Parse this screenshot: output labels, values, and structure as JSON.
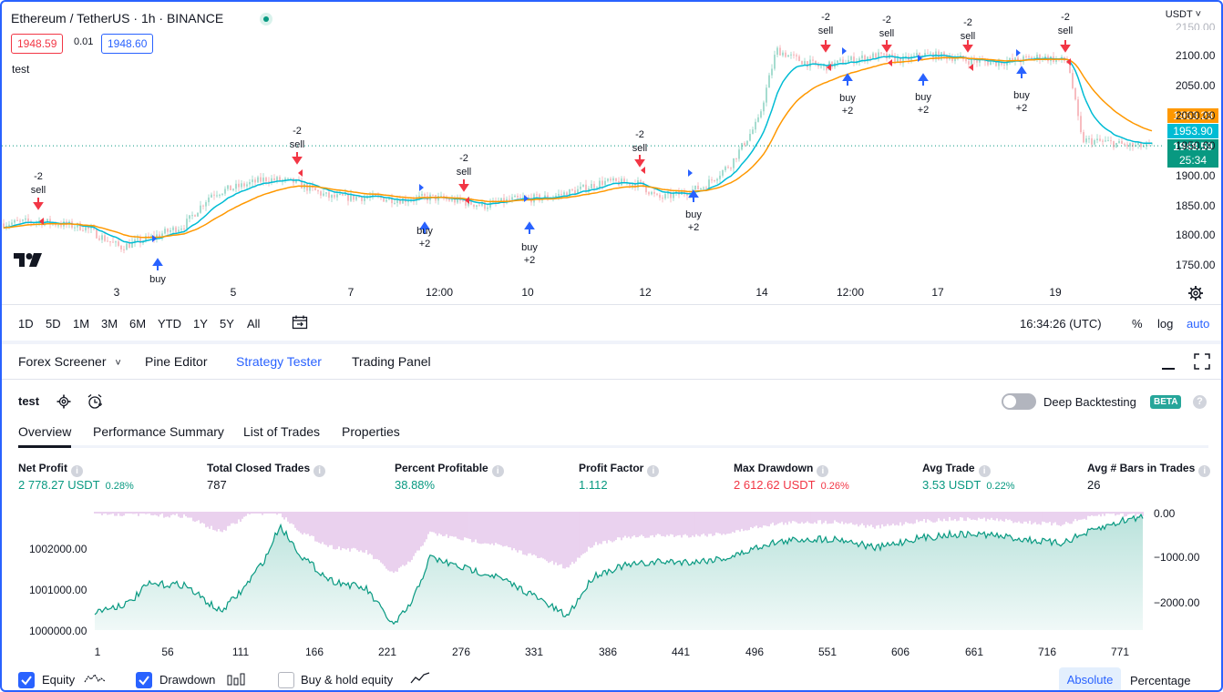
{
  "chart": {
    "symbol": "Ethereum",
    "quote": "TetherUS",
    "interval": "1h",
    "exchange": "BINANCE",
    "sep1": "/",
    "sep2": "·",
    "sep3": "·",
    "bid": "1948.59",
    "spread": "0.01",
    "ask": "1948.60",
    "study_name": "test",
    "currency": "USDT",
    "y_ticks": [
      "2100.00",
      "2050.00",
      "2000.00",
      "1950.00",
      "1900.00",
      "1850.00",
      "1800.00",
      "1750.00"
    ],
    "y_ticks_hidden_top": "2150.00",
    "x_ticks": [
      "3",
      "5",
      "7",
      "12:00",
      "10",
      "12",
      "14",
      "12:00",
      "17",
      "19"
    ],
    "tag_orange": "1963.28",
    "tag_cyan": "1953.90",
    "tag_last": "1948.59",
    "tag_countdown": "25:34",
    "colors": {
      "up": "#089981",
      "down": "#f23645",
      "fast_ma": "#00bcd4",
      "slow_ma": "#ff9800",
      "accent": "#2962ff"
    },
    "signals": [
      {
        "type": "sell",
        "top": "-2",
        "label": "sell"
      },
      {
        "type": "buy",
        "label": "buy",
        "bottom": ""
      },
      {
        "type": "sell",
        "top": "-2",
        "label": "sell"
      },
      {
        "type": "sell",
        "top": "-2",
        "label": "sell"
      },
      {
        "type": "buy",
        "label": "buy",
        "bottom": "+2"
      },
      {
        "type": "buy",
        "label": "buy",
        "bottom": "+2"
      },
      {
        "type": "sell",
        "top": "-2",
        "label": "sell"
      },
      {
        "type": "buy",
        "label": "buy",
        "bottom": "+2"
      },
      {
        "type": "sell",
        "top": "-2",
        "label": "sell"
      },
      {
        "type": "buy",
        "label": "buy",
        "bottom": "+2"
      },
      {
        "type": "sell",
        "top": "-2",
        "label": "sell"
      },
      {
        "type": "buy",
        "label": "buy",
        "bottom": "+2"
      },
      {
        "type": "sell",
        "top": "-2",
        "label": "sell"
      },
      {
        "type": "buy",
        "label": "buy",
        "bottom": "+2"
      },
      {
        "type": "sell",
        "top": "-2",
        "label": "sell"
      }
    ]
  },
  "range_bar": {
    "ranges": [
      "1D",
      "5D",
      "1M",
      "3M",
      "6M",
      "YTD",
      "1Y",
      "5Y",
      "All"
    ],
    "clock": "16:34:26 (UTC)",
    "percent": "%",
    "log": "log",
    "auto": "auto"
  },
  "panel_tabs": {
    "screener": "Forex Screener",
    "pine": "Pine Editor",
    "tester": "Strategy Tester",
    "trading": "Trading Panel"
  },
  "strategy": {
    "name": "test",
    "deep_backtesting": "Deep Backtesting",
    "beta": "BETA",
    "subtabs": [
      "Overview",
      "Performance Summary",
      "List of Trades",
      "Properties"
    ]
  },
  "metrics": [
    {
      "label": "Net Profit",
      "value": "2 778.27 USDT",
      "pct": "0.28%",
      "color": "green"
    },
    {
      "label": "Total Closed Trades",
      "value": "787",
      "pct": "",
      "color": "neutral"
    },
    {
      "label": "Percent Profitable",
      "value": "38.88%",
      "pct": "",
      "color": "green"
    },
    {
      "label": "Profit Factor",
      "value": "1.112",
      "pct": "",
      "color": "green"
    },
    {
      "label": "Max Drawdown",
      "value": "2 612.62 USDT",
      "pct": "0.26%",
      "color": "red"
    },
    {
      "label": "Avg Trade",
      "value": "3.53 USDT",
      "pct": "0.22%",
      "color": "green"
    },
    {
      "label": "Avg # Bars in Trades",
      "value": "26",
      "pct": "",
      "color": "neutral"
    }
  ],
  "equity_chart": {
    "left_ticks": [
      "1002000.00",
      "1001000.00",
      "1000000.00"
    ],
    "right_ticks": [
      "0.00",
      "−1000.00",
      "−2000.00"
    ],
    "x_ticks": [
      "1",
      "56",
      "111",
      "166",
      "221",
      "276",
      "331",
      "386",
      "441",
      "496",
      "551",
      "606",
      "661",
      "716",
      "771"
    ],
    "colors": {
      "equity": "#089981",
      "drawdown": "#ce93d8"
    }
  },
  "footer": {
    "equity": "Equity",
    "drawdown": "Drawdown",
    "buy_hold": "Buy & hold equity",
    "absolute": "Absolute",
    "percentage": "Percentage"
  }
}
